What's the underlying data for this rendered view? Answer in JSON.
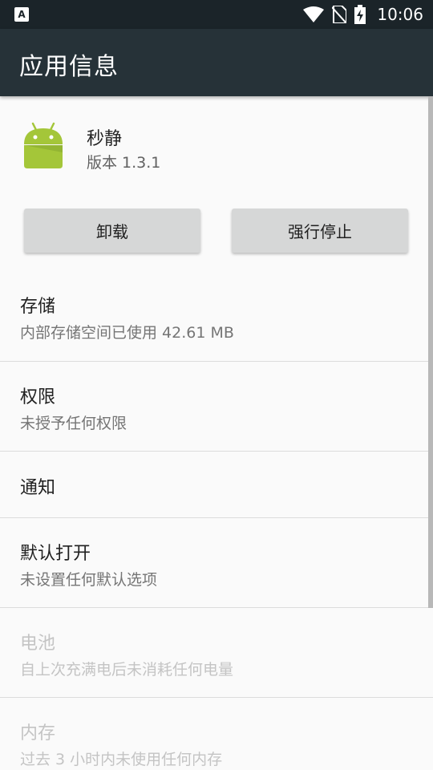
{
  "status_bar": {
    "left_icon_label": "A",
    "time": "10:06",
    "icons": [
      "wifi-icon",
      "no-sim-icon",
      "battery-charging-icon"
    ]
  },
  "app_bar": {
    "title": "应用信息"
  },
  "app": {
    "name": "秒静",
    "version": "版本 1.3.1",
    "icon": "android-icon",
    "icon_color": "#a4c639"
  },
  "buttons": {
    "uninstall": "卸载",
    "force_stop": "强行停止"
  },
  "rows": [
    {
      "title": "存储",
      "subtitle": "内部存储空间已使用 42.61 MB",
      "enabled": true
    },
    {
      "title": "权限",
      "subtitle": "未授予任何权限",
      "enabled": true
    },
    {
      "title": "通知",
      "subtitle": "",
      "enabled": true
    },
    {
      "title": "默认打开",
      "subtitle": "未设置任何默认选项",
      "enabled": true
    },
    {
      "title": "电池",
      "subtitle": "自上次充满电后未消耗任何电量",
      "enabled": false
    },
    {
      "title": "内存",
      "subtitle": "过去 3 小时内未使用任何内存",
      "enabled": false
    }
  ],
  "colors": {
    "app_bar": "#263238",
    "status_bar": "#1b2429",
    "button": "#d6d7d7"
  }
}
